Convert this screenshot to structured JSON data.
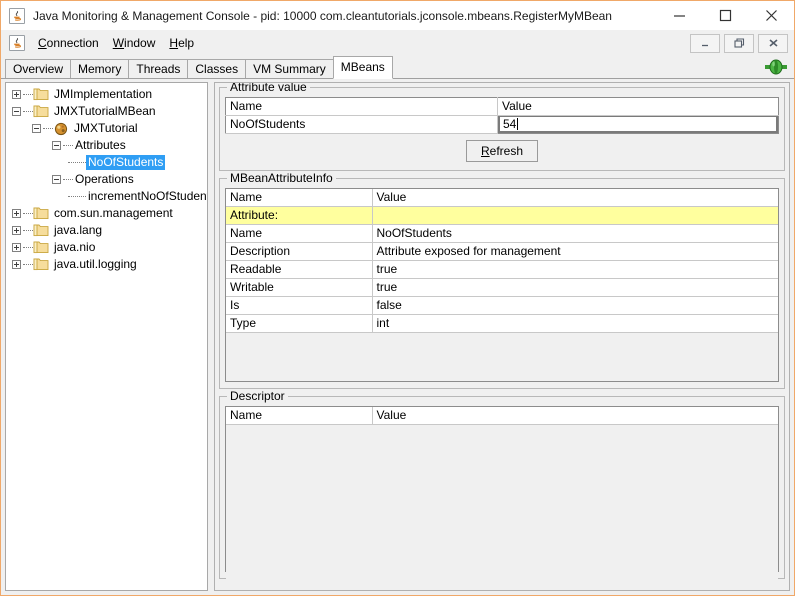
{
  "window": {
    "title": "Java Monitoring & Management Console - pid: 10000 com.cleantutorials.jconsole.mbeans.RegisterMyMBean",
    "app_icon": "java-cup-icon",
    "controls": {
      "minimize": "minimize-icon",
      "maximize": "maximize-icon",
      "close": "close-icon"
    }
  },
  "menubar": {
    "icon": "java-cup-icon",
    "items": [
      {
        "mnemonic": "C",
        "rest": "onnection"
      },
      {
        "mnemonic": "W",
        "rest": "indow"
      },
      {
        "mnemonic": "H",
        "rest": "elp"
      }
    ],
    "internal_frame_controls": {
      "minimize": "minimize-icon",
      "restore": "restore-icon",
      "close": "close-icon"
    }
  },
  "tabs": {
    "items": [
      "Overview",
      "Memory",
      "Threads",
      "Classes",
      "VM Summary",
      "MBeans"
    ],
    "active": "MBeans",
    "status_icon": "green-plug-connected-icon"
  },
  "tree": {
    "nodes": [
      {
        "label": "JMImplementation",
        "depth": 0,
        "handle": "plus",
        "icon": "folder-icon"
      },
      {
        "label": "JMXTutorialMBean",
        "depth": 0,
        "handle": "minus",
        "icon": "folder-icon"
      },
      {
        "label": "JMXTutorial",
        "depth": 1,
        "handle": "minus",
        "icon": "mbean-icon"
      },
      {
        "label": "Attributes",
        "depth": 2,
        "handle": "minus",
        "icon": "none"
      },
      {
        "label": "NoOfStudents",
        "depth": 3,
        "handle": "leaf",
        "icon": "none",
        "selected": true
      },
      {
        "label": "Operations",
        "depth": 2,
        "handle": "minus",
        "icon": "none"
      },
      {
        "label": "incrementNoOfStudents",
        "depth": 3,
        "handle": "leaf",
        "icon": "none"
      },
      {
        "label": "com.sun.management",
        "depth": 0,
        "handle": "plus",
        "icon": "folder-icon"
      },
      {
        "label": "java.lang",
        "depth": 0,
        "handle": "plus",
        "icon": "folder-icon"
      },
      {
        "label": "java.nio",
        "depth": 0,
        "handle": "plus",
        "icon": "folder-icon"
      },
      {
        "label": "java.util.logging",
        "depth": 0,
        "handle": "plus",
        "icon": "folder-icon"
      }
    ]
  },
  "attribute_value": {
    "legend": "Attribute value",
    "columns": [
      "Name",
      "Value"
    ],
    "row": {
      "name": "NoOfStudents",
      "value": "54"
    },
    "refresh_button": {
      "mnemonic": "R",
      "rest": "efresh"
    }
  },
  "mbean_attribute_info": {
    "legend": "MBeanAttributeInfo",
    "columns": [
      "Name",
      "Value"
    ],
    "rows": [
      {
        "name": "Attribute:",
        "value": "",
        "highlight": true
      },
      {
        "name": "Name",
        "value": "NoOfStudents"
      },
      {
        "name": "Description",
        "value": "Attribute exposed for management"
      },
      {
        "name": "Readable",
        "value": "true"
      },
      {
        "name": "Writable",
        "value": "true"
      },
      {
        "name": "Is",
        "value": "false"
      },
      {
        "name": "Type",
        "value": "int"
      }
    ]
  },
  "descriptor": {
    "legend": "Descriptor",
    "columns": [
      "Name",
      "Value"
    ],
    "rows": []
  },
  "colors": {
    "highlight_row": "#ffff9e",
    "tree_selection": "#2f9ef4",
    "window_border": "#f0a868",
    "panel_bg": "#f0f0f0",
    "status_green": "#2f8f2f"
  }
}
